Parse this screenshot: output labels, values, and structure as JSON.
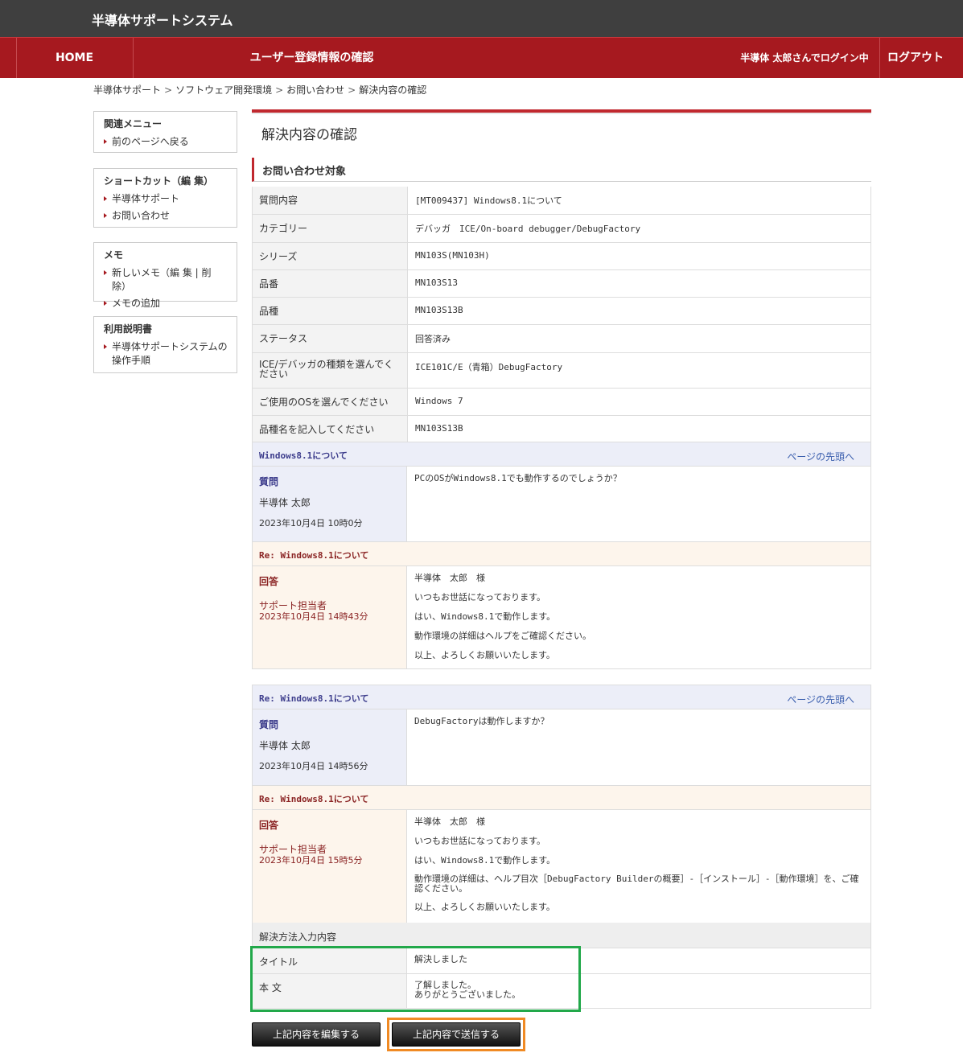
{
  "app": {
    "title": "半導体サポートシステム"
  },
  "nav": {
    "home": "HOME",
    "page": "ユーザー登録情報の確認",
    "login_status": "半導体 太郎さんでログイン中",
    "logout": "ログアウト"
  },
  "breadcrumb": [
    "半導体サポート",
    "ソフトウェア開発環境",
    "お問い合わせ",
    "解決内容の確認"
  ],
  "sidebar": {
    "related": {
      "title": "関連メニュー",
      "items": [
        "前のページへ戻る"
      ]
    },
    "shortcut": {
      "title": "ショートカット（編 集）",
      "items": [
        "半導体サポート",
        "お問い合わせ"
      ]
    },
    "memo": {
      "title": "メモ",
      "items": [
        "新しいメモ（編 集 | 削 除）",
        "メモの追加"
      ]
    },
    "manual": {
      "title": "利用説明書",
      "items": [
        "半導体サポートシステムの操作手順"
      ]
    }
  },
  "main": {
    "title": "解決内容の確認",
    "section": "お問い合わせ対象",
    "info": [
      {
        "key": "質問内容",
        "value": "[MT009437] Windows8.1について"
      },
      {
        "key": "カテゴリー",
        "value": "デバッガ　ICE/On-board debugger/DebugFactory"
      },
      {
        "key": "シリーズ",
        "value": "MN103S(MN103H)"
      },
      {
        "key": "品番",
        "value": "MN103S13"
      },
      {
        "key": "品種",
        "value": "MN103S13B"
      },
      {
        "key": "ステータス",
        "value": "回答済み"
      },
      {
        "key": "ICE/デバッガの種類を選んでください",
        "value": "ICE101C/E（青箱）DebugFactory"
      },
      {
        "key": "ご使用のOSを選んでください",
        "value": "Windows 7"
      },
      {
        "key": "品種名を記入してください",
        "value": "MN103S13B"
      }
    ],
    "page_top": "ページの先頭へ",
    "threads": [
      {
        "q_title": "Windows8.1について",
        "q_label": "質問",
        "q_who": "半導体 太郎",
        "q_when": "2023年10月4日 10時0分",
        "q_body": "PCのOSがWindows8.1でも動作するのでしょうか？",
        "a_title": "Re: Windows8.1について",
        "a_label": "回答",
        "a_who": "サポート担当者",
        "a_when": "2023年10月4日 14時43分",
        "a_body": [
          "半導体　太郎　様",
          "いつもお世話になっております。",
          "はい、Windows8.1で動作します。",
          "動作環境の詳細はヘルプをご確認ください。",
          "以上、よろしくお願いいたします。"
        ]
      },
      {
        "q_title": "Re: Windows8.1について",
        "q_label": "質問",
        "q_who": "半導体 太郎",
        "q_when": "2023年10月4日 14時56分",
        "q_body": "DebugFactoryは動作しますか？",
        "a_title": "Re: Windows8.1について",
        "a_label": "回答",
        "a_who": "サポート担当者",
        "a_when": "2023年10月4日 15時5分",
        "a_body": [
          "半導体　太郎　様",
          "いつもお世話になっております。",
          "はい、Windows8.1で動作します。",
          "動作環境の詳細は、ヘルプ目次［DebugFactory Builderの概要］-［インストール］-［動作環境］を、ご確認ください。",
          "以上、よろしくお願いいたします。"
        ]
      }
    ],
    "resolve": {
      "head": "解決方法入力内容",
      "title_key": "タイトル",
      "title_value": "解決しました",
      "body_key": "本 文",
      "body_line1": "了解しました。",
      "body_line2": "ありがとうございました。"
    },
    "buttons": {
      "edit": "上記内容を編集する",
      "send": "上記内容で送信する"
    }
  }
}
